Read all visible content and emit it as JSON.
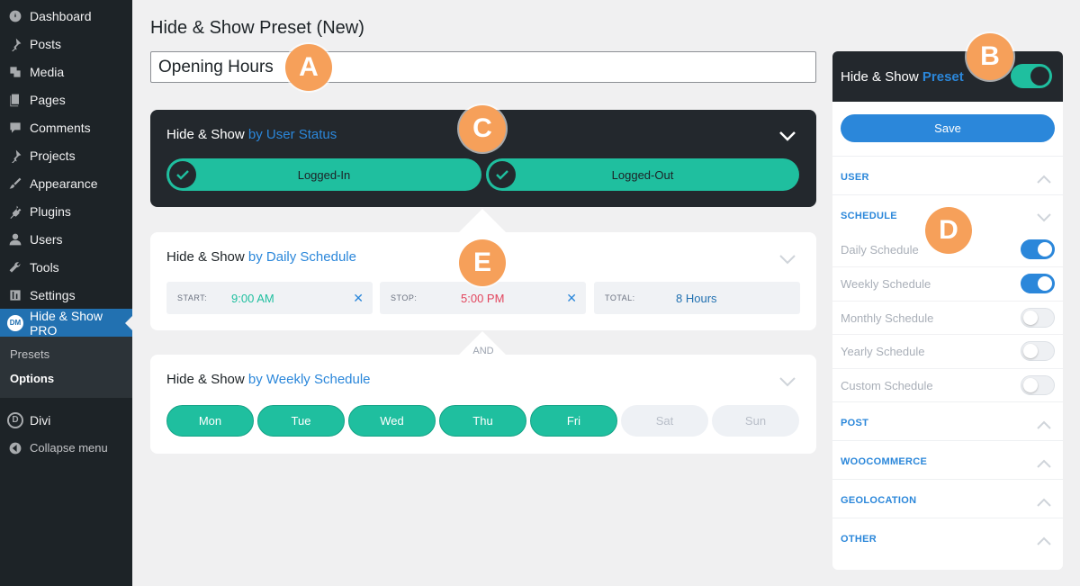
{
  "sidebar": {
    "items": [
      {
        "label": "Dashboard",
        "icon": "dashboard-icon"
      },
      {
        "label": "Posts",
        "icon": "pin-icon"
      },
      {
        "label": "Media",
        "icon": "media-icon"
      },
      {
        "label": "Pages",
        "icon": "pages-icon"
      },
      {
        "label": "Comments",
        "icon": "comment-icon"
      },
      {
        "label": "Projects",
        "icon": "pin-icon"
      },
      {
        "label": "Appearance",
        "icon": "brush-icon"
      },
      {
        "label": "Plugins",
        "icon": "plug-icon"
      },
      {
        "label": "Users",
        "icon": "user-icon"
      },
      {
        "label": "Tools",
        "icon": "wrench-icon"
      },
      {
        "label": "Settings",
        "icon": "sliders-icon"
      }
    ],
    "active": {
      "label": "Hide & Show PRO",
      "badge": "DM"
    },
    "submenu": [
      "Presets",
      "Options"
    ],
    "divi": {
      "label": "Divi",
      "badge": "D"
    },
    "collapse": "Collapse menu"
  },
  "page": {
    "title": "Hide & Show Preset (New)",
    "preset_name": "Opening Hours"
  },
  "user_status": {
    "prefix": "Hide & Show",
    "highlight": "by User Status",
    "options": [
      "Logged-In",
      "Logged-Out"
    ]
  },
  "daily": {
    "prefix": "Hide & Show",
    "highlight": "by Daily Schedule",
    "start_label": "START:",
    "start_value": "9:00 AM",
    "stop_label": "STOP:",
    "stop_value": "5:00 PM",
    "total_label": "TOTAL:",
    "total_value": "8 Hours",
    "clear": "✕"
  },
  "connector": "AND",
  "weekly": {
    "prefix": "Hide & Show",
    "highlight": "by Weekly Schedule",
    "days": [
      {
        "label": "Mon",
        "on": true
      },
      {
        "label": "Tue",
        "on": true
      },
      {
        "label": "Wed",
        "on": true
      },
      {
        "label": "Thu",
        "on": true
      },
      {
        "label": "Fri",
        "on": true
      },
      {
        "label": "Sat",
        "on": false
      },
      {
        "label": "Sun",
        "on": false
      }
    ]
  },
  "panel": {
    "title_prefix": "Hide & Show",
    "title_highlight": "Preset",
    "enabled": true,
    "save_label": "Save",
    "sections": {
      "user": "USER",
      "schedule": "SCHEDULE",
      "post": "POST",
      "woocommerce": "WOOCOMMERCE",
      "geolocation": "GEOLOCATION",
      "other": "OTHER"
    },
    "schedule_options": [
      {
        "label": "Daily Schedule",
        "on": true
      },
      {
        "label": "Weekly Schedule",
        "on": true
      },
      {
        "label": "Monthly Schedule",
        "on": false
      },
      {
        "label": "Yearly Schedule",
        "on": false
      },
      {
        "label": "Custom Schedule",
        "on": false
      }
    ]
  },
  "markers": [
    "A",
    "B",
    "C",
    "D",
    "E"
  ],
  "colors": {
    "accent_blue": "#2b87da",
    "teal": "#1fbf9f",
    "dark": "#23282d",
    "stop_red": "#e2445c",
    "marker_orange": "#f6a05a"
  }
}
